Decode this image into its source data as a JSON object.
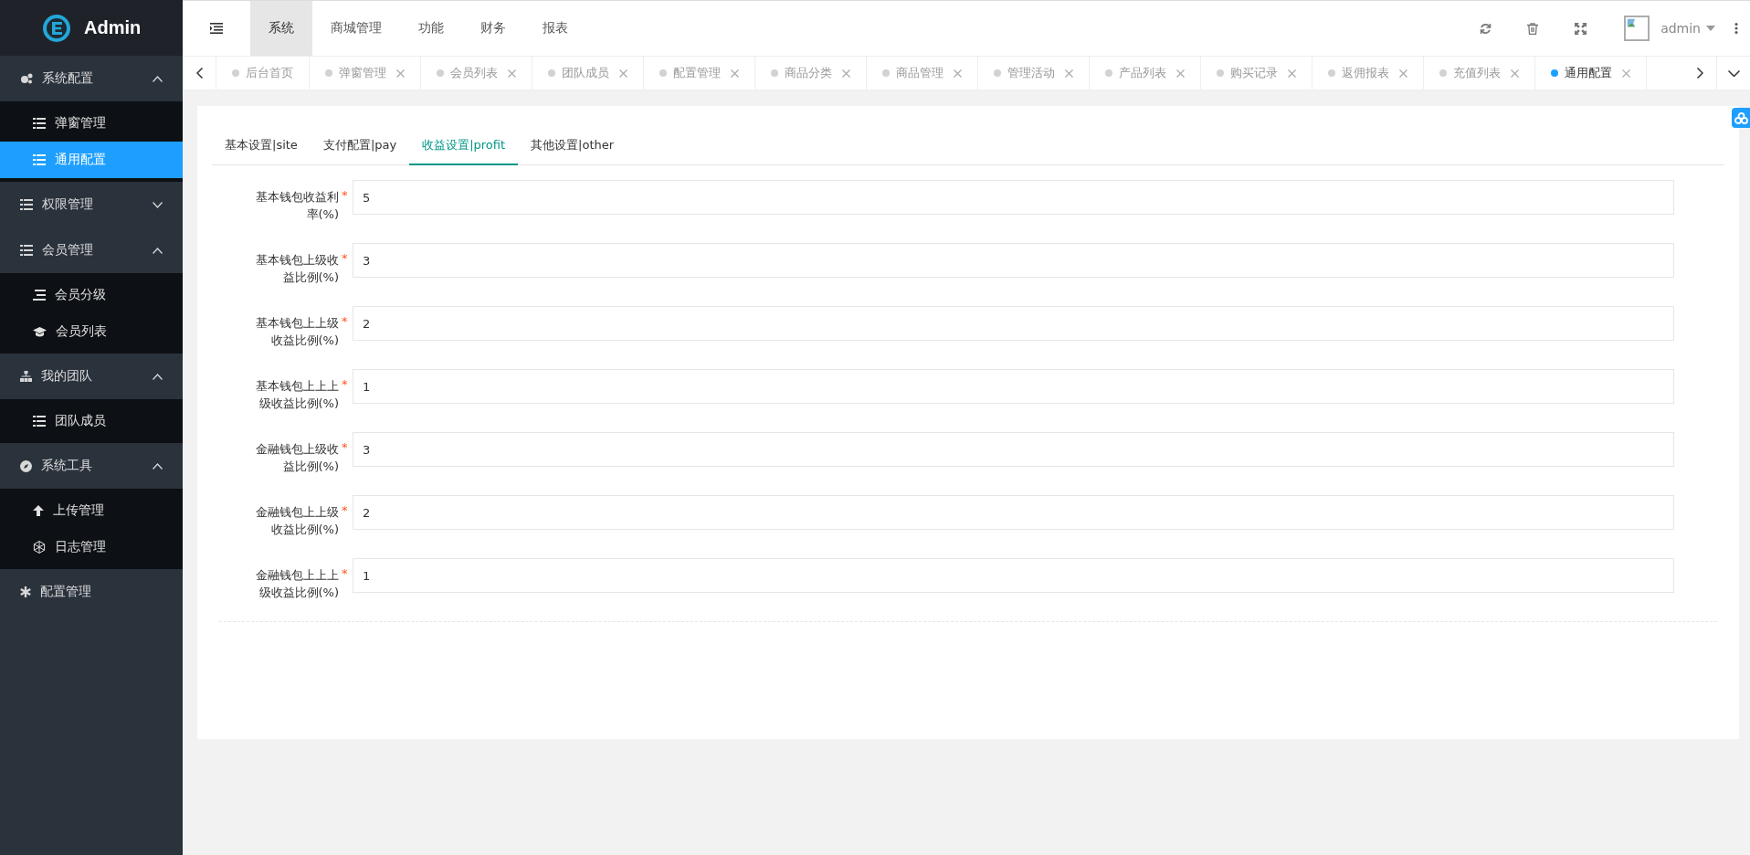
{
  "header": {
    "logo": "Admin",
    "nav": [
      {
        "label": "系统",
        "selected": true
      },
      {
        "label": "商城管理",
        "selected": false
      },
      {
        "label": "功能",
        "selected": false
      },
      {
        "label": "财务",
        "selected": false
      },
      {
        "label": "报表",
        "selected": false
      }
    ],
    "user": "admin"
  },
  "sidebar": {
    "groups": [
      {
        "label": "系统配置",
        "expanded": true,
        "children": [
          {
            "label": "弹窗管理",
            "selected": false
          },
          {
            "label": "通用配置",
            "selected": true
          }
        ]
      },
      {
        "label": "权限管理",
        "expanded": false
      },
      {
        "label": "会员管理",
        "expanded": true,
        "children": [
          {
            "label": "会员分级",
            "selected": false
          },
          {
            "label": "会员列表",
            "selected": false
          }
        ]
      },
      {
        "label": "我的团队",
        "expanded": true,
        "children": [
          {
            "label": "团队成员",
            "selected": false
          }
        ]
      },
      {
        "label": "系统工具",
        "expanded": true,
        "children": [
          {
            "label": "上传管理",
            "selected": false
          },
          {
            "label": "日志管理",
            "selected": false
          }
        ]
      },
      {
        "label": "配置管理"
      }
    ]
  },
  "page_tabs": [
    {
      "label": "后台首页",
      "selected": false,
      "closable": false
    },
    {
      "label": "弹窗管理",
      "selected": false,
      "closable": true
    },
    {
      "label": "会员列表",
      "selected": false,
      "closable": true
    },
    {
      "label": "团队成员",
      "selected": false,
      "closable": true
    },
    {
      "label": "配置管理",
      "selected": false,
      "closable": true
    },
    {
      "label": "商品分类",
      "selected": false,
      "closable": true
    },
    {
      "label": "商品管理",
      "selected": false,
      "closable": true
    },
    {
      "label": "管理活动",
      "selected": false,
      "closable": true
    },
    {
      "label": "产品列表",
      "selected": false,
      "closable": true
    },
    {
      "label": "购买记录",
      "selected": false,
      "closable": true
    },
    {
      "label": "返佣报表",
      "selected": false,
      "closable": true
    },
    {
      "label": "充值列表",
      "selected": false,
      "closable": true
    },
    {
      "label": "通用配置",
      "selected": true,
      "closable": true
    }
  ],
  "form": {
    "tabs": [
      {
        "label": "基本设置|site",
        "selected": false
      },
      {
        "label": "支付配置|pay",
        "selected": false
      },
      {
        "label": "收益设置|profit",
        "selected": true
      },
      {
        "label": "其他设置|other",
        "selected": false
      }
    ],
    "fields": [
      {
        "label": "基本钱包收益利率(%)",
        "required_mark": "*",
        "value": "5"
      },
      {
        "label": "基本钱包上级收益比例(%)",
        "required_mark": "*",
        "value": "3"
      },
      {
        "label": "基本钱包上上级收益比例(%)",
        "required_mark": "*",
        "value": "2"
      },
      {
        "label": "基本钱包上上上级收益比例(%)",
        "required_mark": "*",
        "value": "1"
      },
      {
        "label": "金融钱包上级收益比例(%)",
        "required_mark": "*",
        "value": "3"
      },
      {
        "label": "金融钱包上上级收益比例(%)",
        "required_mark": "*",
        "value": "2"
      },
      {
        "label": "金融钱包上上上级收益比例(%)",
        "required_mark": "*",
        "value": "1"
      }
    ]
  }
}
